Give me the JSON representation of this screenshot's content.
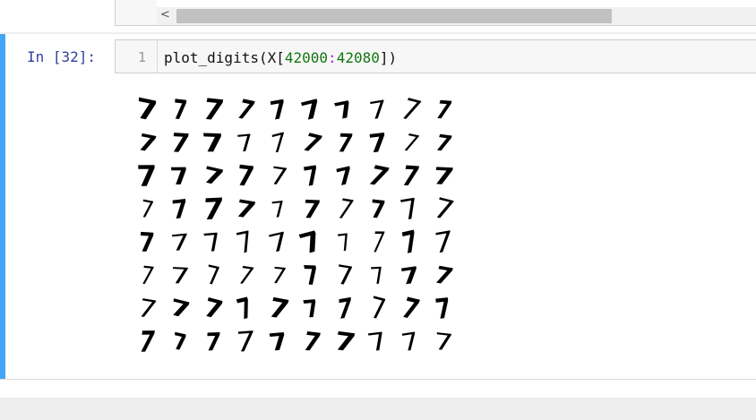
{
  "prompt": "In [32]:",
  "line_number": "1",
  "code": {
    "fn": "plot_digits",
    "open": "(X[",
    "start": "42000",
    "colon": ":",
    "end": "42080",
    "close": "])"
  },
  "scroll_arrow": "<",
  "output": {
    "glyph": "7",
    "rows": 8,
    "cols": 10,
    "images": 80
  }
}
